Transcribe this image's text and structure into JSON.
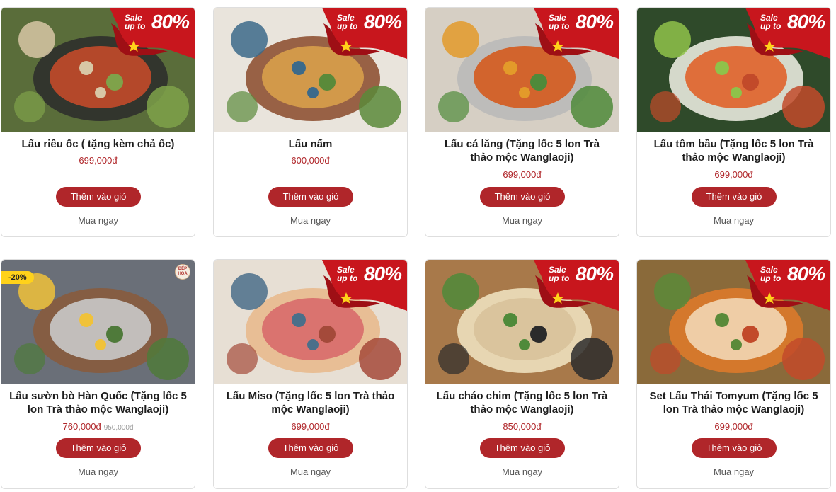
{
  "sale_badge": {
    "line1": "Sale",
    "line2": "up to",
    "value": "80%"
  },
  "add_to_cart_label": "Thêm vào giỏ",
  "buy_now_label": "Mua ngay",
  "colors": {
    "accent": "#b0262a",
    "badge_yellow": "#ffd21a",
    "flag_star": "#ffd21a"
  },
  "products": [
    {
      "name": "Lẩu riêu ốc ( tặng kèm chả ốc)",
      "price": "699,000đ",
      "old_price": "",
      "discount": "",
      "has_sale_badge": true,
      "image_icon": "snail-hotpot-image"
    },
    {
      "name": "Lẩu nấm",
      "price": "600,000đ",
      "old_price": "",
      "discount": "",
      "has_sale_badge": true,
      "image_icon": "mushroom-hotpot-image"
    },
    {
      "name": "Lẩu cá lăng (Tặng lốc 5 lon Trà thảo mộc Wanglaoji)",
      "price": "699,000đ",
      "old_price": "",
      "discount": "",
      "has_sale_badge": true,
      "image_icon": "fish-hotpot-image"
    },
    {
      "name": "Lẩu tôm bầu (Tặng lốc 5 lon Trà thảo mộc Wanglaoji)",
      "price": "699,000đ",
      "old_price": "",
      "discount": "",
      "has_sale_badge": true,
      "image_icon": "shrimp-hotpot-image"
    },
    {
      "name": "Lẩu sườn bò Hàn Quốc (Tặng lốc 5 lon Trà thảo mộc Wanglaoji)",
      "price": "760,000đ",
      "old_price": "950,000đ",
      "discount": "-20%",
      "has_sale_badge": false,
      "brand_logo": "BẾP HOA",
      "image_icon": "beef-rib-hotpot-image"
    },
    {
      "name": "Lẩu Miso (Tặng lốc 5 lon Trà thảo mộc Wanglaoji)",
      "price": "699,000đ",
      "old_price": "",
      "discount": "",
      "has_sale_badge": true,
      "image_icon": "miso-hotpot-image"
    },
    {
      "name": "Lẩu cháo chim (Tặng lốc 5 lon Trà thảo mộc Wanglaoji)",
      "price": "850,000đ",
      "old_price": "",
      "discount": "",
      "has_sale_badge": true,
      "image_icon": "bird-porridge-hotpot-image"
    },
    {
      "name": "Set Lẩu Thái Tomyum (Tặng lốc 5 lon Trà thảo mộc Wanglaoji)",
      "price": "699,000đ",
      "old_price": "",
      "discount": "",
      "has_sale_badge": true,
      "image_icon": "tomyum-hotpot-image"
    }
  ]
}
